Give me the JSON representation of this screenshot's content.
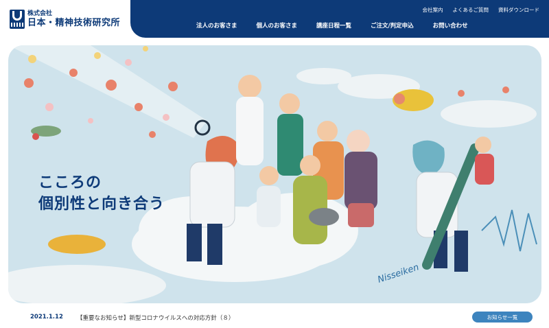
{
  "brand": {
    "logo_sub": "株式会社",
    "logo_main": "日本・精神技術研究所",
    "color": "#0d3a78"
  },
  "util_nav": [
    "会社案内",
    "よくあるご質問",
    "資料ダウンロード"
  ],
  "main_nav": [
    "法人のお客さま",
    "個人のお客さま",
    "講座日程一覧",
    "ご注文/判定申込",
    "お問い合わせ"
  ],
  "hero": {
    "catch_line1": "こころの",
    "catch_line2": "個別性と向き合う",
    "signature": "Nisseiken"
  },
  "news": {
    "date": "2021.1.12",
    "title": "【重要なお知らせ】新型コロナウイルスへの対応方針（８）",
    "button": "お知らせ一覧",
    "button_color": "#3d84be"
  }
}
